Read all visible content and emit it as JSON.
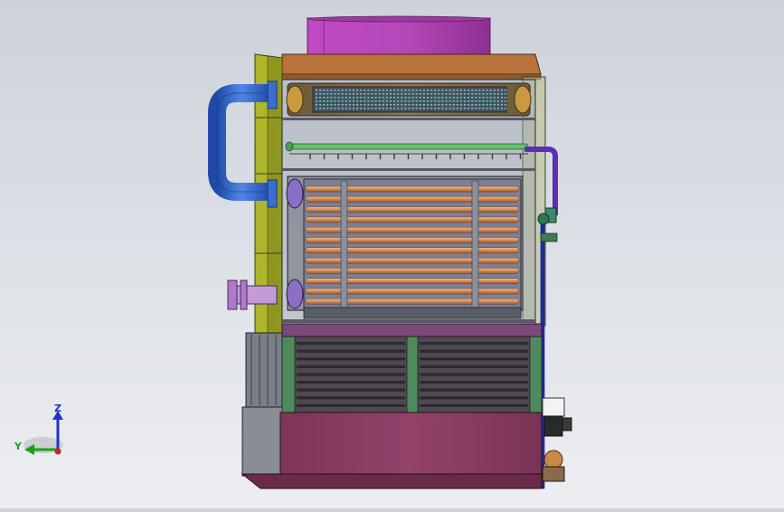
{
  "colors": {
    "background_top": "#cdd2da",
    "background_bottom": "#eceef1",
    "fan_stack": "#b447b8",
    "top_frame": "#b8733e",
    "side_frame": "#aeb62a",
    "heat_exchanger_tubes": "#d89a6a",
    "blue_pipe": "#3a6fd1",
    "green_pipe": "#63c26b",
    "purple_inlet": "#c49ad8",
    "louvre_section": "#4f4a52",
    "green_post": "#4f8a5c",
    "basin": "#8c3d61",
    "rail_navy": "#1f2bb0"
  },
  "triad": {
    "z_label": "Z",
    "y_label": "Y",
    "z_color": "#2030d0",
    "y_color": "#1aa01a",
    "x_color": "#d02020"
  }
}
